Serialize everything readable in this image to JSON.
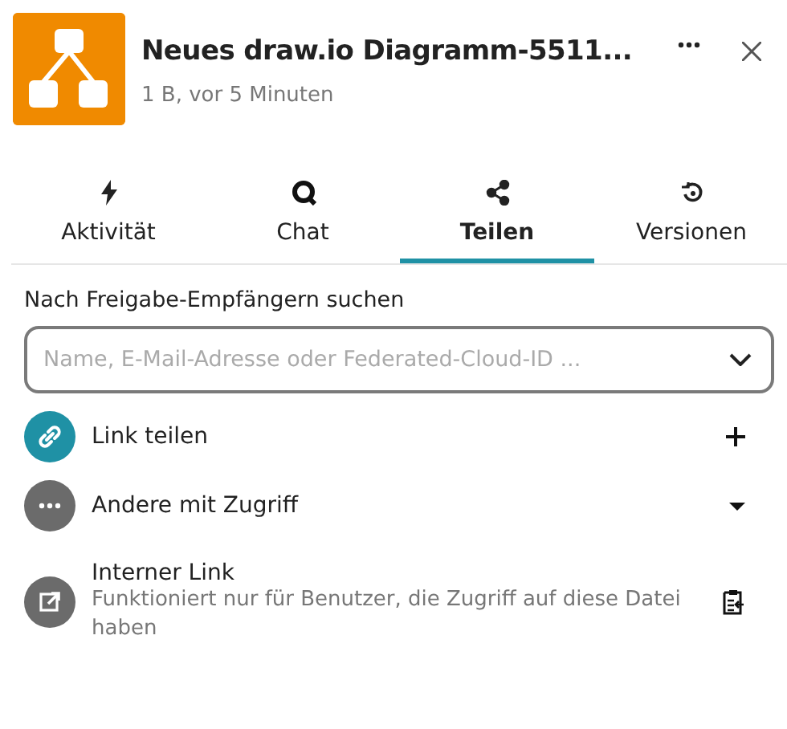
{
  "header": {
    "title": "Neues draw.io Diagramm-5511...",
    "subtitle": "1 B, vor 5 Minuten"
  },
  "tabs": [
    {
      "kind": "activity",
      "label": "Aktivität",
      "selected": false
    },
    {
      "kind": "chat",
      "label": "Chat",
      "selected": false
    },
    {
      "kind": "share",
      "label": "Teilen",
      "selected": true
    },
    {
      "kind": "versions",
      "label": "Versionen",
      "selected": false
    }
  ],
  "search": {
    "label": "Nach Freigabe-Empfängern suchen",
    "placeholder": "Name, E-Mail-Adresse oder Federated-Cloud-ID ..."
  },
  "entries": [
    {
      "kind": "share-link",
      "title": "Link teilen"
    },
    {
      "kind": "others",
      "title": "Andere mit Zugriff"
    },
    {
      "kind": "internal-link",
      "title": "Interner Link",
      "description": "Funktioniert nur für Benutzer, die Zugriff auf diese Datei haben"
    }
  ]
}
